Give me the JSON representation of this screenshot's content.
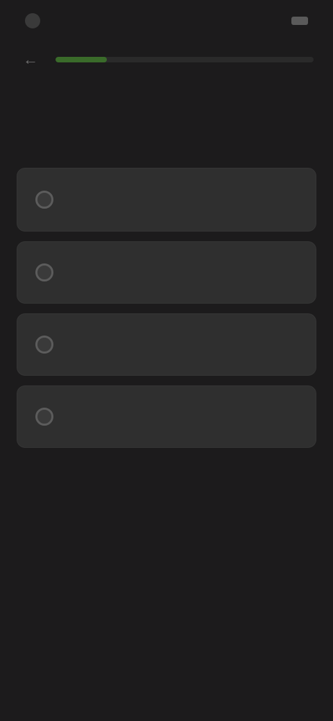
{
  "status_bar": {
    "time": "",
    "right": ""
  },
  "header": {
    "back_icon": "arrow-left-icon",
    "progress": 0.2
  },
  "page": {
    "title": ""
  },
  "options": [
    {
      "label": ""
    },
    {
      "label": ""
    },
    {
      "label": ""
    },
    {
      "label": ""
    }
  ],
  "colors": {
    "background": "#1c1b1c",
    "card": "#2f2f2f",
    "progress_fill": "#3a6b2a"
  }
}
